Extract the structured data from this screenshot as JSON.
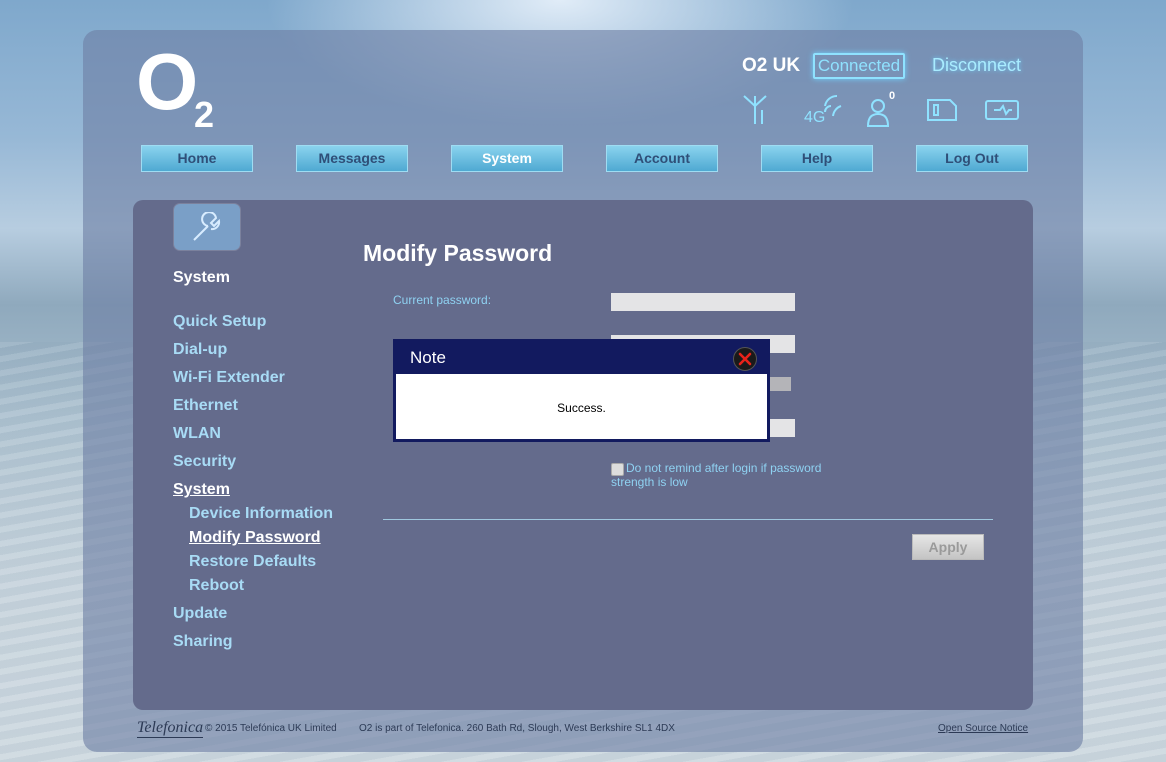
{
  "header": {
    "logo_main": "O",
    "logo_sub": "2",
    "carrier": "O2 UK",
    "connection_status": "Connected",
    "disconnect_label": "Disconnect",
    "notification_count": "0",
    "network_type": "4G"
  },
  "nav": [
    "Home",
    "Messages",
    "System",
    "Account",
    "Help",
    "Log Out"
  ],
  "sidebar": {
    "title": "System",
    "items": [
      "Quick Setup",
      "Dial-up",
      "Wi-Fi Extender",
      "Ethernet",
      "WLAN",
      "Security",
      "System"
    ],
    "subitems": [
      "Device Information",
      "Modify Password",
      "Restore Defaults",
      "Reboot"
    ],
    "items_after": [
      "Update",
      "Sharing"
    ],
    "active_item": "System",
    "active_subitem": "Modify Password"
  },
  "main": {
    "title": "Modify Password",
    "current_password_label": "Current password:",
    "checkbox_label": "Do not remind after login if password strength is low",
    "apply_label": "Apply"
  },
  "modal": {
    "title": "Note",
    "message": "Success."
  },
  "footer": {
    "brand": "Telefonica",
    "copyright": "© 2015 Telefónica UK Limited",
    "address": "O2 is part of Telefonica. 260 Bath Rd, Slough, West Berkshire SL1 4DX",
    "link": "Open Source Notice"
  },
  "colors": {
    "accent": "#8fe2ff",
    "modal_header": "#121a5f",
    "panel": "#646b8c",
    "nav_button": "#4fa9d2"
  }
}
